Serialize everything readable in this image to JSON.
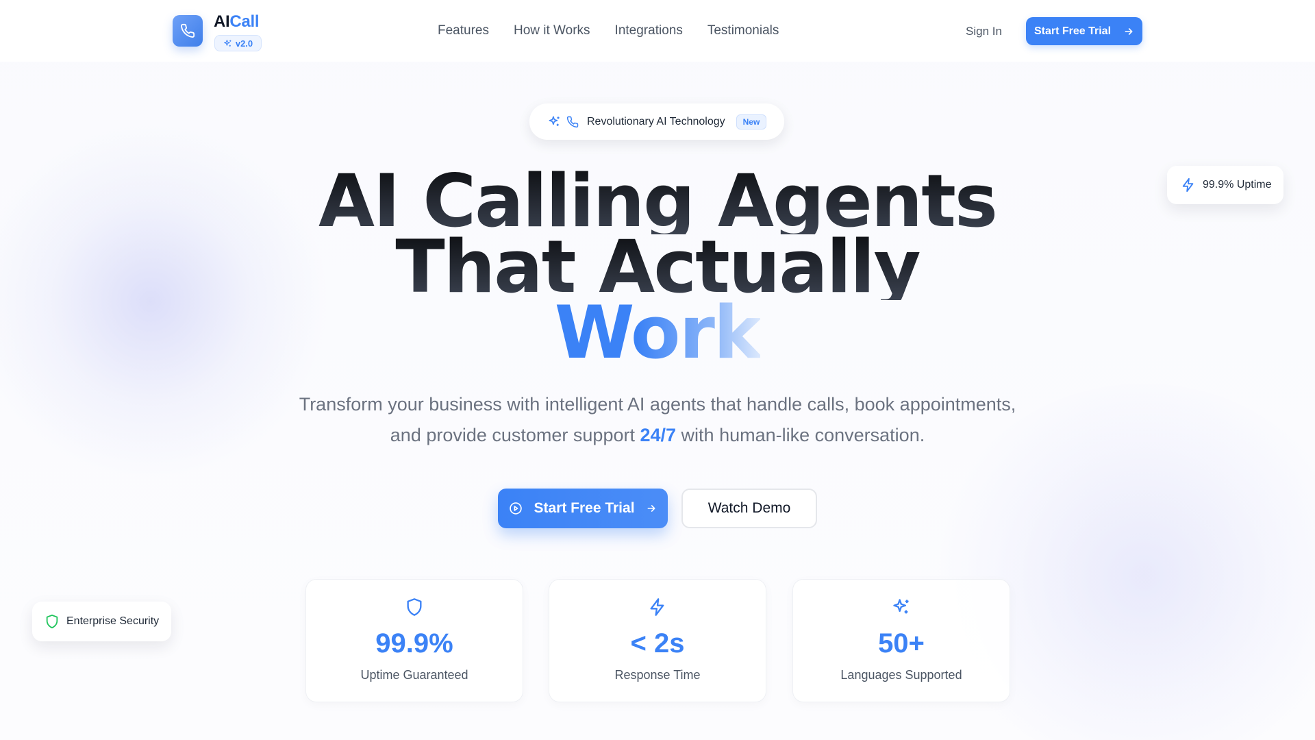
{
  "brand": {
    "name_ai": "AI",
    "name_call": "Call",
    "version": "v2.0",
    "accent_color": "#3b82f6",
    "logo_icon": "phone-icon"
  },
  "nav": {
    "links": [
      "Features",
      "How it Works",
      "Integrations",
      "Testimonials"
    ],
    "sign_in": "Sign In",
    "cta": "Start Free Trial"
  },
  "hero": {
    "badge_text": "Revolutionary AI Technology",
    "badge_tag": "New",
    "headline_line1": "AI Calling Agents",
    "headline_line2": "That Actually",
    "headline_line3": "Work",
    "subtitle_before": "Transform your business with intelligent AI agents that handle calls, book appointments, and provide customer support ",
    "subtitle_highlight": "24/7",
    "subtitle_after": " with human-like conversation.",
    "primary_cta": "Start Free Trial",
    "secondary_cta": "Watch Demo"
  },
  "floating": {
    "uptime": "99.9% Uptime",
    "security": "Enterprise Security"
  },
  "stats": [
    {
      "icon": "shield-icon",
      "value": "99.9%",
      "label": "Uptime Guaranteed"
    },
    {
      "icon": "lightning-icon",
      "value": "< 2s",
      "label": "Response Time"
    },
    {
      "icon": "sparkles-icon",
      "value": "50+",
      "label": "Languages Supported"
    }
  ]
}
